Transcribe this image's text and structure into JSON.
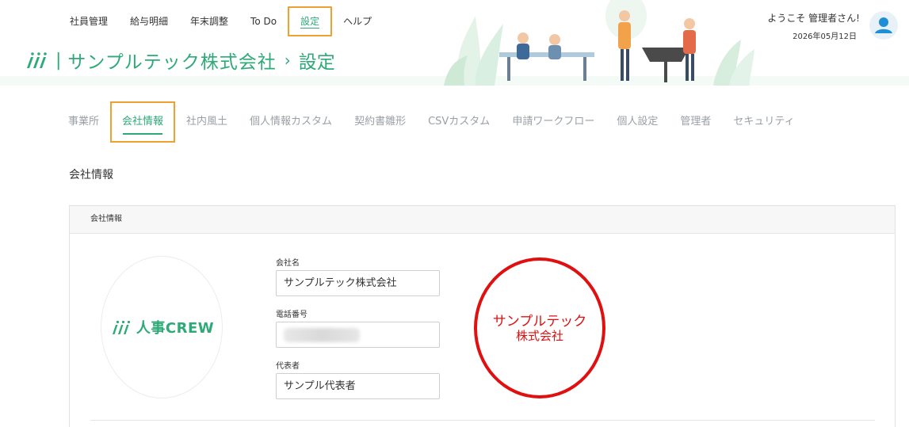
{
  "nav": {
    "items": [
      {
        "label": "社員管理",
        "active": false
      },
      {
        "label": "給与明細",
        "active": false
      },
      {
        "label": "年末調整",
        "active": false
      },
      {
        "label": "To Do",
        "active": false
      },
      {
        "label": "設定",
        "active": true
      },
      {
        "label": "ヘルプ",
        "active": false
      }
    ]
  },
  "user": {
    "welcome": "ようこそ 管理者さん!",
    "date": "2026年05月12日"
  },
  "header": {
    "company": "サンプルテック株式会社",
    "separator": "›",
    "current": "設定"
  },
  "subtabs": [
    {
      "label": "事業所",
      "active": false
    },
    {
      "label": "会社情報",
      "active": true
    },
    {
      "label": "社内風土",
      "active": false
    },
    {
      "label": "個人情報カスタム",
      "active": false
    },
    {
      "label": "契約書雛形",
      "active": false
    },
    {
      "label": "CSVカスタム",
      "active": false
    },
    {
      "label": "申請ワークフロー",
      "active": false
    },
    {
      "label": "個人設定",
      "active": false
    },
    {
      "label": "管理者",
      "active": false
    },
    {
      "label": "セキュリティ",
      "active": false
    }
  ],
  "section": {
    "title": "会社情報"
  },
  "card": {
    "header": "会社情報",
    "logo_text": "人事CREW",
    "fields": {
      "company_name_label": "会社名",
      "company_name_value": "サンプルテック株式会社",
      "phone_label": "電話番号",
      "phone_value": "",
      "representative_label": "代表者",
      "representative_value": "サンプル代表者"
    },
    "seal": {
      "line1": "サンプルテック",
      "line2": "株式会社"
    }
  },
  "colors": {
    "brand": "#2eaa78",
    "highlight": "#f0a030",
    "seal": "#e01010",
    "inactive_tab": "#9aa0a6"
  }
}
